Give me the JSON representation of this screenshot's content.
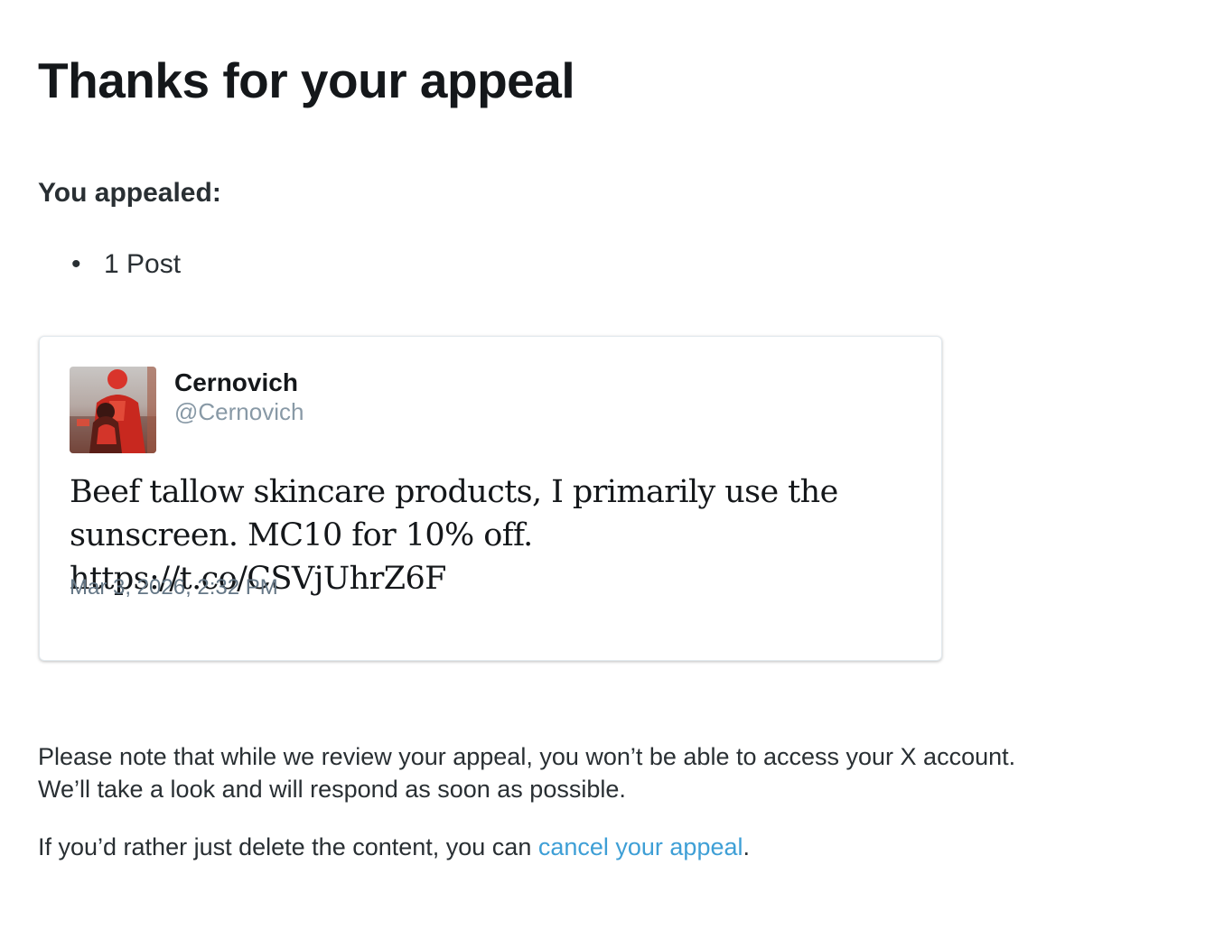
{
  "page": {
    "title": "Thanks for your appeal"
  },
  "appealed": {
    "heading": "You appealed:",
    "items": [
      {
        "bullet": "•",
        "label": "1 Post"
      }
    ]
  },
  "tweet": {
    "display_name": "Cernovich",
    "handle": "@Cernovich",
    "avatar_icon": "user-photo-avatar",
    "text": "Beef tallow skincare products, I primarily use the sunscreen. MC10 for 10% off. https://t.co/CSVjUhrZ6F",
    "timestamp": "Mar 3, 2026, 2:32 PM"
  },
  "notice": {
    "line1": "Please note that while we review your appeal, you won’t be able to access your X account.",
    "line2": "We’ll take a look and will respond as soon as possible."
  },
  "cancel": {
    "prefix": "If you’d rather just delete the content, you can ",
    "link_label": "cancel your appeal",
    "suffix": "."
  },
  "colors": {
    "link": "#3e9fd6",
    "handle": "#8899a6",
    "timestamp": "#657786",
    "text": "#14171a"
  }
}
